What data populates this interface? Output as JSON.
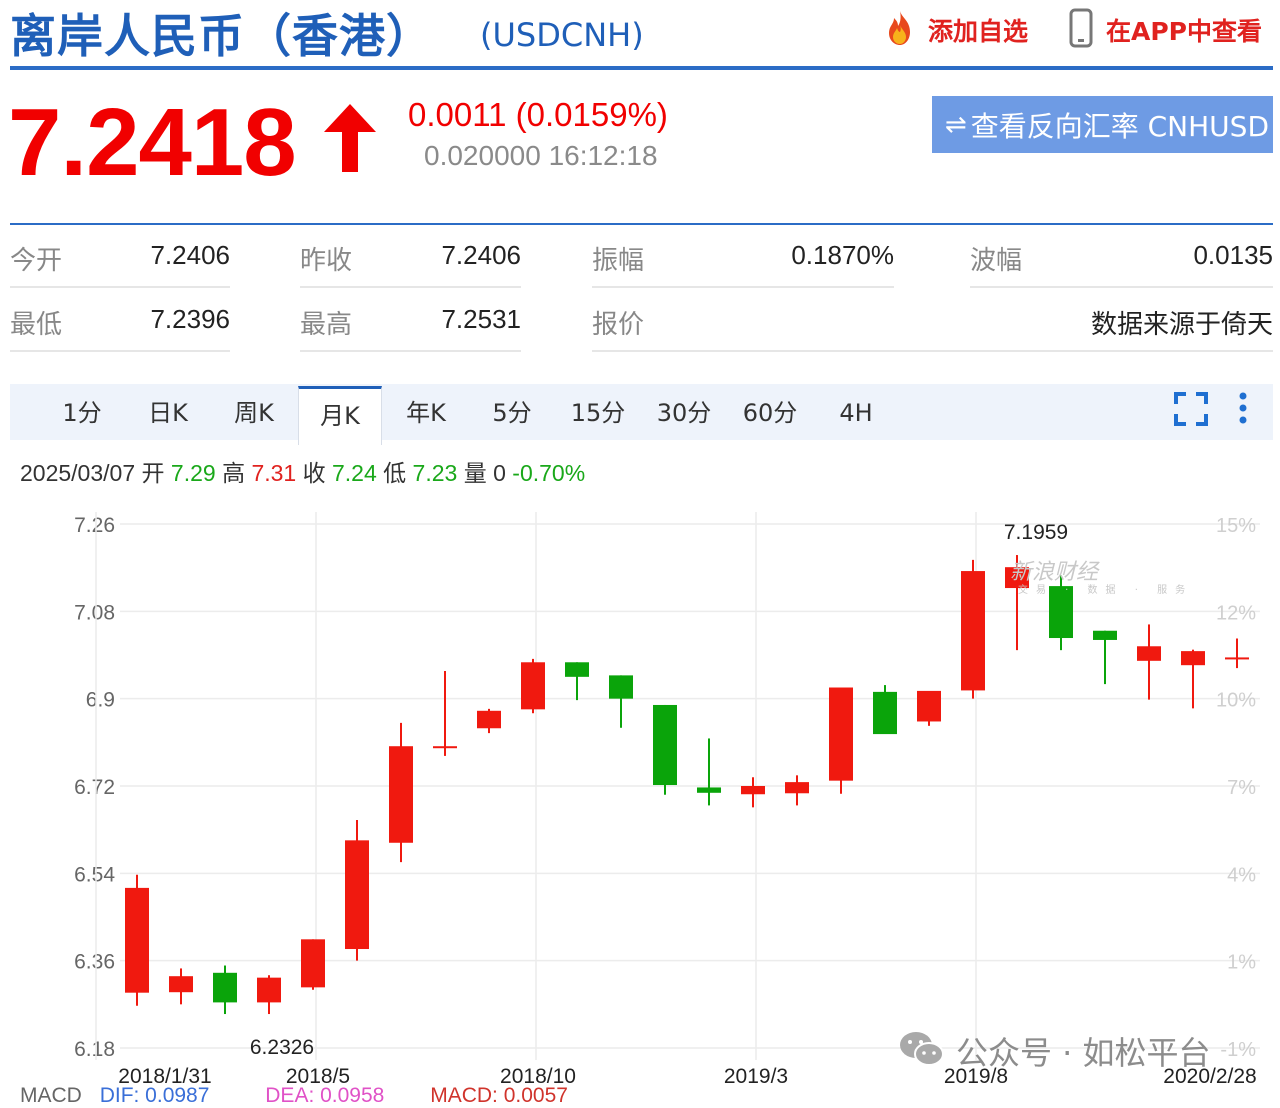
{
  "header": {
    "title": "离岸人民币（香港）",
    "code": "(USDCNH)",
    "add_favorite": "添加自选",
    "view_in_app": "在APP中查看"
  },
  "quote": {
    "price": "7.2418",
    "change": "0.0011 (0.0159%)",
    "spread_time": "0.020000 16:12:18",
    "reverse_button": "查看反向汇率 CNHUSD",
    "trend": "up",
    "price_color": "#f10000"
  },
  "stats": [
    {
      "label": "今开",
      "value": "7.2406"
    },
    {
      "label": "昨收",
      "value": "7.2406"
    },
    {
      "label": "振幅",
      "value": "0.1870%"
    },
    {
      "label": "波幅",
      "value": "0.0135"
    },
    {
      "label": "最低",
      "value": "7.2396"
    },
    {
      "label": "最高",
      "value": "7.2531"
    },
    {
      "label": "报价",
      "value": ""
    },
    {
      "label": "",
      "value": "数据来源于倚天"
    }
  ],
  "tabs": [
    "1分",
    "日K",
    "周K",
    "月K",
    "年K",
    "5分",
    "15分",
    "30分",
    "60分",
    "4H"
  ],
  "active_tab": "月K",
  "ohlc_line": {
    "date": "2025/03/07",
    "open_label": "开",
    "open": "7.29",
    "high_label": "高",
    "high": "7.31",
    "close_label": "收",
    "close": "7.24",
    "low_label": "低",
    "low": "7.23",
    "vol_label": "量",
    "vol": "0",
    "pct": "-0.70%"
  },
  "watermark": {
    "brand": "新浪财经",
    "sub": "交易 · 数据 · 服务"
  },
  "wechat_mark": "公众号 · 如松平台",
  "macd": {
    "label": "MACD",
    "dif": "DIF: 0.0987",
    "dea": "DEA: 0.0958",
    "macd": "MACD: 0.0057"
  },
  "chart_data": {
    "type": "candlestick",
    "y_ticks": [
      "7.26",
      "7.08",
      "6.9",
      "6.72",
      "6.54",
      "6.36",
      "6.18"
    ],
    "ylim": [
      6.18,
      7.26
    ],
    "right_ticks": [
      "15%",
      "12%",
      "10%",
      "7%",
      "4%",
      "1%",
      "-1%"
    ],
    "x_ticks": [
      "2018/1/31",
      "2018/5",
      "2018/10",
      "2019/3",
      "2019/8",
      "2020/2/28"
    ],
    "annotations": {
      "max_label": "7.1959",
      "min_label": "6.2326"
    },
    "candles": [
      {
        "o": 6.294,
        "h": 6.537,
        "l": 6.267,
        "c": 6.51
      },
      {
        "o": 6.295,
        "h": 6.344,
        "l": 6.27,
        "c": 6.328
      },
      {
        "o": 6.335,
        "h": 6.35,
        "l": 6.25,
        "c": 6.274
      },
      {
        "o": 6.274,
        "h": 6.33,
        "l": 6.25,
        "c": 6.325
      },
      {
        "o": 6.305,
        "h": 6.404,
        "l": 6.3,
        "c": 6.404
      },
      {
        "o": 6.384,
        "h": 6.65,
        "l": 6.36,
        "c": 6.608
      },
      {
        "o": 6.603,
        "h": 6.85,
        "l": 6.563,
        "c": 6.802
      },
      {
        "o": 6.802,
        "h": 6.957,
        "l": 6.782,
        "c": 6.802
      },
      {
        "o": 6.839,
        "h": 6.879,
        "l": 6.829,
        "c": 6.875
      },
      {
        "o": 6.878,
        "h": 6.982,
        "l": 6.87,
        "c": 6.975
      },
      {
        "o": 6.975,
        "h": 6.975,
        "l": 6.897,
        "c": 6.945
      },
      {
        "o": 6.948,
        "h": 6.948,
        "l": 6.84,
        "c": 6.9
      },
      {
        "o": 6.887,
        "h": 6.887,
        "l": 6.702,
        "c": 6.722
      },
      {
        "o": 6.717,
        "h": 6.818,
        "l": 6.68,
        "c": 6.706
      },
      {
        "o": 6.703,
        "h": 6.738,
        "l": 6.676,
        "c": 6.72
      },
      {
        "o": 6.705,
        "h": 6.742,
        "l": 6.68,
        "c": 6.728
      },
      {
        "o": 6.731,
        "h": 6.922,
        "l": 6.704,
        "c": 6.923
      },
      {
        "o": 6.914,
        "h": 6.928,
        "l": 6.848,
        "c": 6.827
      },
      {
        "o": 6.853,
        "h": 6.872,
        "l": 6.844,
        "c": 6.916
      },
      {
        "o": 6.917,
        "h": 7.186,
        "l": 6.9,
        "c": 7.163
      },
      {
        "o": 7.128,
        "h": 7.196,
        "l": 7.0,
        "c": 7.171
      },
      {
        "o": 7.132,
        "h": 7.154,
        "l": 7.0,
        "c": 7.025
      },
      {
        "o": 7.04,
        "h": 7.04,
        "l": 6.93,
        "c": 7.021
      },
      {
        "o": 6.978,
        "h": 7.053,
        "l": 6.898,
        "c": 7.008
      },
      {
        "o": 6.969,
        "h": 7.001,
        "l": 6.88,
        "c": 6.998
      },
      {
        "o": 6.981,
        "h": 7.024,
        "l": 6.963,
        "c": 6.985
      }
    ],
    "colors": {
      "up": "#f0190f",
      "down": "#0aa40a"
    }
  }
}
